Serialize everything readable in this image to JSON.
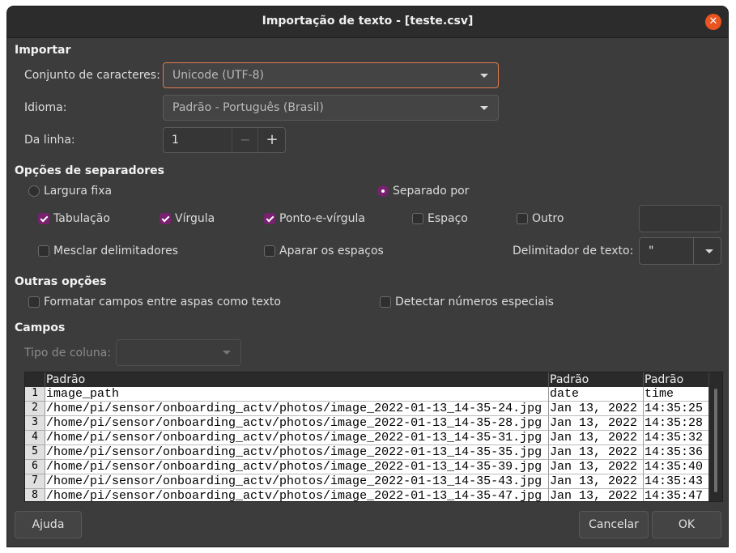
{
  "window": {
    "title": "Importação de texto - [teste.csv]"
  },
  "import": {
    "section": "Importar",
    "charset_label": "Conjunto de caracteres:",
    "charset_value": "Unicode (UTF-8)",
    "language_label": "Idioma:",
    "language_value": "Padrão - Português (Brasil)",
    "from_row_label": "Da linha:",
    "from_row_value": "1"
  },
  "separators": {
    "section": "Opções de separadores",
    "fixed_width": "Largura fixa",
    "separated_by": "Separado por",
    "tab": "Tabulação",
    "comma": "Vírgula",
    "semicolon": "Ponto-e-vírgula",
    "space": "Espaço",
    "other": "Outro",
    "merge": "Mesclar delimitadores",
    "trim": "Aparar os espaços",
    "text_delim_label": "Delimitador de texto:",
    "text_delim_value": "\""
  },
  "other_options": {
    "section": "Outras opções",
    "quoted_as_text": "Formatar campos entre aspas como texto",
    "detect_special": "Detectar números especiais"
  },
  "fields": {
    "section": "Campos",
    "column_type_label": "Tipo de coluna:",
    "columns": [
      "Padrão",
      "Padrão",
      "Padrão"
    ],
    "rows": [
      [
        "1",
        "image_path",
        "date",
        "time"
      ],
      [
        "2",
        "/home/pi/sensor/onboarding_actv/photos/image_2022-01-13_14-35-24.jpg",
        "Jan 13, 2022",
        "14:35:25"
      ],
      [
        "3",
        "/home/pi/sensor/onboarding_actv/photos/image_2022-01-13_14-35-28.jpg",
        "Jan 13, 2022",
        "14:35:28"
      ],
      [
        "4",
        "/home/pi/sensor/onboarding_actv/photos/image_2022-01-13_14-35-31.jpg",
        "Jan 13, 2022",
        "14:35:32"
      ],
      [
        "5",
        "/home/pi/sensor/onboarding_actv/photos/image_2022-01-13_14-35-35.jpg",
        "Jan 13, 2022",
        "14:35:36"
      ],
      [
        "6",
        "/home/pi/sensor/onboarding_actv/photos/image_2022-01-13_14-35-39.jpg",
        "Jan 13, 2022",
        "14:35:40"
      ],
      [
        "7",
        "/home/pi/sensor/onboarding_actv/photos/image_2022-01-13_14-35-43.jpg",
        "Jan 13, 2022",
        "14:35:43"
      ],
      [
        "8",
        "/home/pi/sensor/onboarding_actv/photos/image_2022-01-13_14-35-47.jpg",
        "Jan 13, 2022",
        "14:35:47"
      ]
    ]
  },
  "buttons": {
    "help": "Ajuda",
    "cancel": "Cancelar",
    "ok": "OK"
  },
  "colors": {
    "accent": "#77216f",
    "close": "#e95420",
    "focus": "#e07a4f"
  }
}
